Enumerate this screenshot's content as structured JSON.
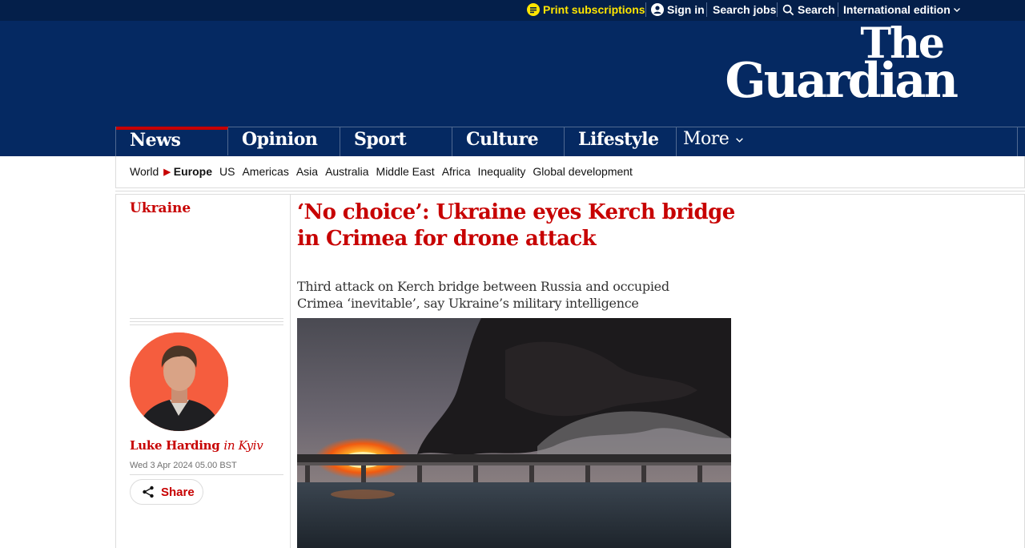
{
  "topbar": {
    "print_subscriptions": "Print subscriptions",
    "sign_in": "Sign in",
    "search_jobs": "Search jobs",
    "search": "Search",
    "edition": "International edition"
  },
  "logo": {
    "line1": "The",
    "line2": "Guardian"
  },
  "pillars": [
    {
      "label": "News",
      "active": true
    },
    {
      "label": "Opinion"
    },
    {
      "label": "Sport"
    },
    {
      "label": "Culture"
    },
    {
      "label": "Lifestyle"
    },
    {
      "label": "More"
    }
  ],
  "subnav": {
    "items": [
      "World",
      "Europe",
      "US",
      "Americas",
      "Asia",
      "Australia",
      "Middle East",
      "Africa",
      "Inequality",
      "Global development"
    ],
    "current": "Europe"
  },
  "article": {
    "section": "Ukraine",
    "headline": "‘No choice’: Ukraine eyes Kerch bridge in Crimea for drone attack",
    "standfirst": "Third attack on Kerch bridge between Russia and occupied Crimea ‘inevitable’, say Ukraine’s military intelligence",
    "author": "Luke Harding",
    "location": "in Kyiv",
    "date": "Wed 3 Apr 2024 05.00 BST",
    "share": "Share"
  },
  "icons": {
    "print": "print-subscriptions-icon",
    "user": "user-icon",
    "search": "search-icon",
    "chevron": "chevron-down-icon",
    "share": "share-icon"
  },
  "colors": {
    "brand_dark": "#041f4a",
    "brand": "#052962",
    "news_red": "#c70000",
    "print_yellow": "#ffe500",
    "avatar_bg": "#f55d3e"
  }
}
